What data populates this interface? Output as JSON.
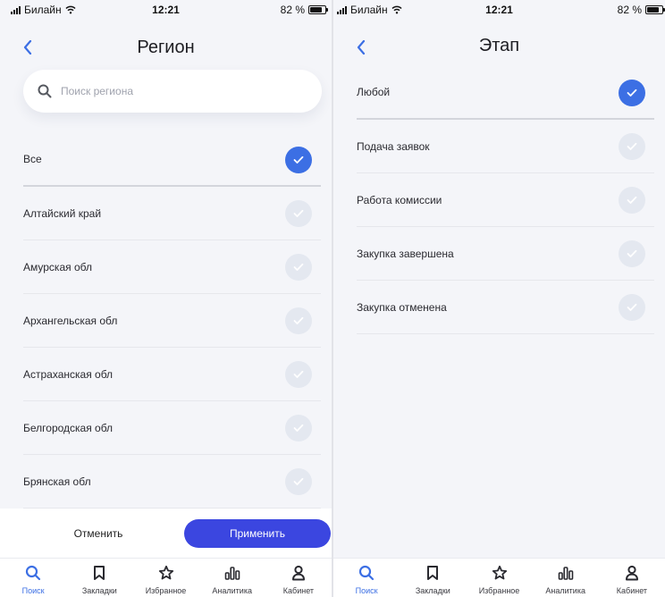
{
  "status": {
    "carrier": "Билайн",
    "time": "12:21",
    "battery": "82 %"
  },
  "left_screen": {
    "title": "Регион",
    "search_placeholder": "Поиск региона",
    "items": [
      {
        "label": "Все",
        "checked": true
      },
      {
        "label": "Алтайский край",
        "checked": false
      },
      {
        "label": "Амурская обл",
        "checked": false
      },
      {
        "label": "Архангельская обл",
        "checked": false
      },
      {
        "label": "Астраханская обл",
        "checked": false
      },
      {
        "label": "Белгородская обл",
        "checked": false
      },
      {
        "label": "Брянская обл",
        "checked": false
      }
    ],
    "cancel_label": "Отменить",
    "apply_label": "Применить"
  },
  "right_screen": {
    "title": "Этап",
    "items": [
      {
        "label": "Любой",
        "checked": true
      },
      {
        "label": "Подача заявок",
        "checked": false
      },
      {
        "label": "Работа комиссии",
        "checked": false
      },
      {
        "label": "Закупка завершена",
        "checked": false
      },
      {
        "label": "Закупка отменена",
        "checked": false
      }
    ]
  },
  "tabs": [
    {
      "label": "Поиск",
      "icon": "search-icon",
      "active": true
    },
    {
      "label": "Закладки",
      "icon": "bookmark-icon",
      "active": false
    },
    {
      "label": "Избранное",
      "icon": "star-icon",
      "active": false
    },
    {
      "label": "Аналитика",
      "icon": "analytics-icon",
      "active": false
    },
    {
      "label": "Кабинет",
      "icon": "user-icon",
      "active": false
    }
  ],
  "colors": {
    "accent": "#3c6fe4",
    "apply_button": "#3b46e0",
    "unchecked": "#e4e8f0",
    "background": "#f4f5f9"
  }
}
